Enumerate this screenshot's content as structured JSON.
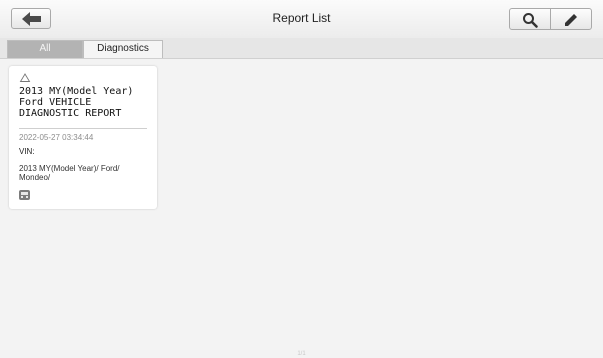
{
  "header": {
    "title": "Report List",
    "icons": {
      "back": "back-arrow-icon",
      "search": "search-icon",
      "edit": "pencil-icon"
    }
  },
  "tabs": [
    {
      "label": "All",
      "active": true
    },
    {
      "label": "Diagnostics",
      "active": false
    }
  ],
  "reports": [
    {
      "icon": "cloud-icon",
      "title": "2013 MY(Model Year)\nFord VEHICLE\nDIAGNOSTIC REPORT",
      "date": "2022-05-27 03:34:44",
      "vin_label": "VIN:",
      "vehicle_path": "2013 MY(Model Year)/ Ford/ Mondeo/",
      "type_icon": "car-icon"
    }
  ],
  "page_indicator": "1/1",
  "colors": {
    "active_tab_bg": "#b3b3b3",
    "background": "#f3f3f3",
    "card_bg": "#ffffff"
  }
}
